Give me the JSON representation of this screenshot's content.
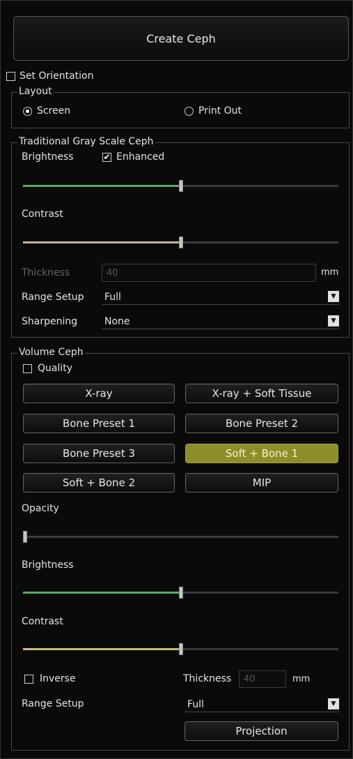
{
  "create_button": "Create Ceph",
  "set_orientation": "Set Orientation",
  "layout": {
    "legend": "Layout",
    "option_screen": "Screen",
    "option_printout": "Print Out"
  },
  "traditional": {
    "legend": "Traditional Gray Scale Ceph",
    "brightness_label": "Brightness",
    "enhanced_label": "Enhanced",
    "enhanced_mark": "✔",
    "contrast_label": "Contrast",
    "brightness_level": 0.5,
    "contrast_level": 0.5,
    "thickness_label": "Thickness",
    "thickness_value": "40",
    "thickness_unit": "mm",
    "range_label": "Range Setup",
    "range_value": "Full",
    "sharpening_label": "Sharpening",
    "sharpening_value": "None"
  },
  "volume": {
    "legend": "Volume Ceph",
    "quality_label": "Quality",
    "presets": [
      "X-ray",
      "X-ray + Soft Tissue",
      "Bone Preset 1",
      "Bone Preset 2",
      "Bone Preset 3",
      "Soft + Bone 1",
      "Soft + Bone 2",
      "MIP"
    ],
    "active_preset": "Soft + Bone 1",
    "opacity_label": "Opacity",
    "opacity_level": 0.0,
    "brightness_label": "Brightness",
    "brightness_level": 0.5,
    "contrast_label": "Contrast",
    "contrast_level": 0.5,
    "inverse_label": "Inverse",
    "thickness_label": "Thickness",
    "thickness_value": "40",
    "thickness_unit": "mm",
    "range_label": "Range Setup",
    "range_value": "Full",
    "projection_button": "Projection"
  },
  "colors": {
    "brightness_fill": "#5daa5d",
    "contrast_fill": "#c8b88a",
    "active_preset": "#8d8d2a"
  }
}
